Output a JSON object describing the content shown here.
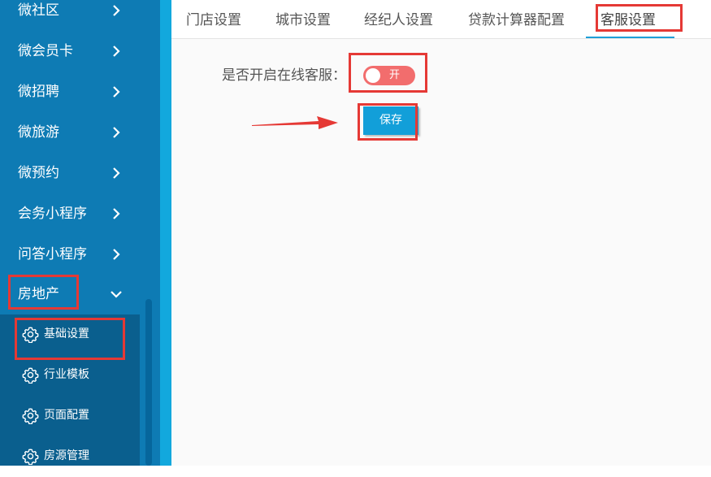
{
  "sidebar": {
    "items": [
      {
        "label": "微社区",
        "icon": "chevron-right-icon"
      },
      {
        "label": "微会员卡",
        "icon": "chevron-right-icon"
      },
      {
        "label": "微招聘",
        "icon": "chevron-right-icon"
      },
      {
        "label": "微旅游",
        "icon": "chevron-right-icon"
      },
      {
        "label": "微预约",
        "icon": "chevron-right-icon"
      },
      {
        "label": "会务小程序",
        "icon": "chevron-right-icon"
      },
      {
        "label": "问答小程序",
        "icon": "chevron-right-icon"
      },
      {
        "label": "房地产",
        "icon": "chevron-down-icon",
        "expanded": true
      }
    ],
    "submenu": [
      {
        "label": "基础设置",
        "icon": "gear-icon",
        "active": true
      },
      {
        "label": "行业模板",
        "icon": "gear-icon"
      },
      {
        "label": "页面配置",
        "icon": "gear-icon"
      },
      {
        "label": "房源管理",
        "icon": "gear-icon"
      }
    ]
  },
  "tabs": [
    {
      "label": "门店设置"
    },
    {
      "label": "城市设置"
    },
    {
      "label": "经纪人设置"
    },
    {
      "label": "贷款计算器配置"
    },
    {
      "label": "客服设置",
      "active": true
    }
  ],
  "form": {
    "online_service_label": "是否开启在线客服：",
    "toggle_text": "开",
    "toggle_on": true,
    "save_label": "保存"
  },
  "colors": {
    "sidebar_bg": "#0e7bb4",
    "submenu_bg": "#0a5f8e",
    "accent": "#129fd9",
    "toggle_on": "#f26d6d",
    "annotation": "#e53935"
  }
}
